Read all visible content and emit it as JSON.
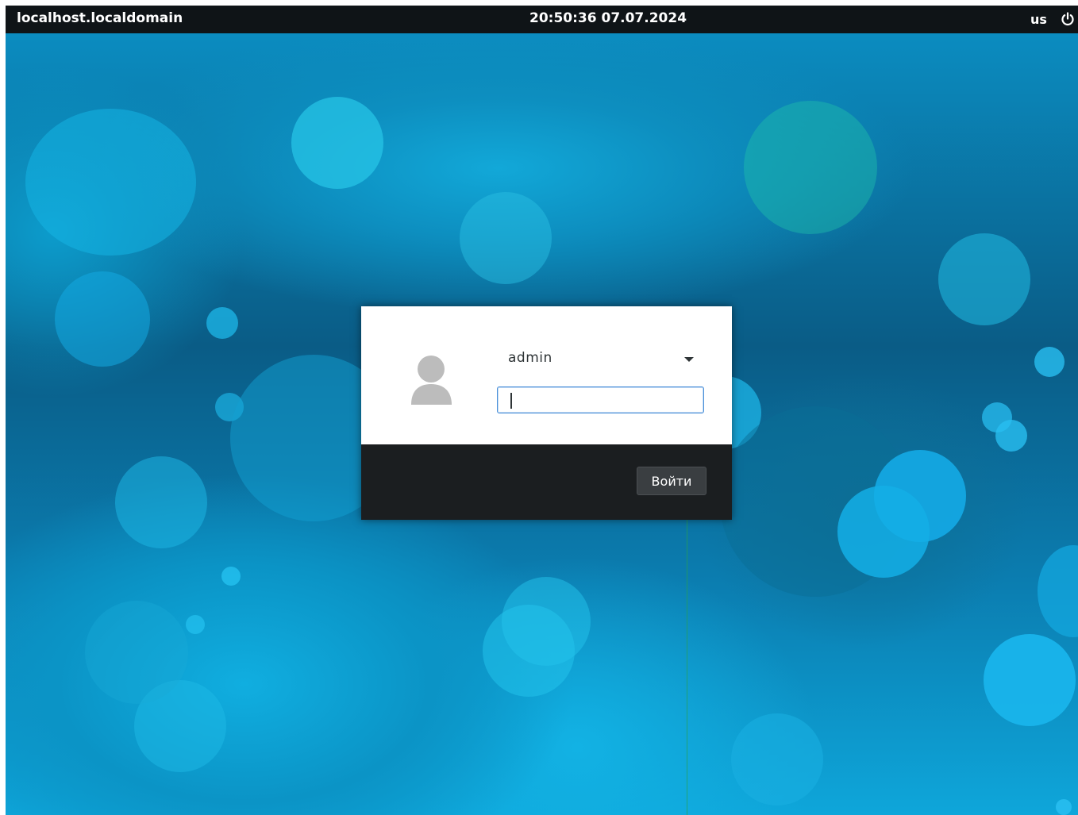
{
  "topbar": {
    "hostname": "localhost.localdomain",
    "clock": "20:50:36 07.07.2024",
    "keyboard_layout": "us",
    "power_icon": "power-icon"
  },
  "login": {
    "avatar_icon": "user-avatar-icon",
    "username": "admin",
    "password_value": "",
    "login_button_label": "Войти"
  },
  "colors": {
    "topbar_bg": "#0f1417",
    "dialog_bottom_bg": "#1b1e20",
    "focus_border": "#4a90d9",
    "wallpaper_accent": "#12a8d8"
  }
}
